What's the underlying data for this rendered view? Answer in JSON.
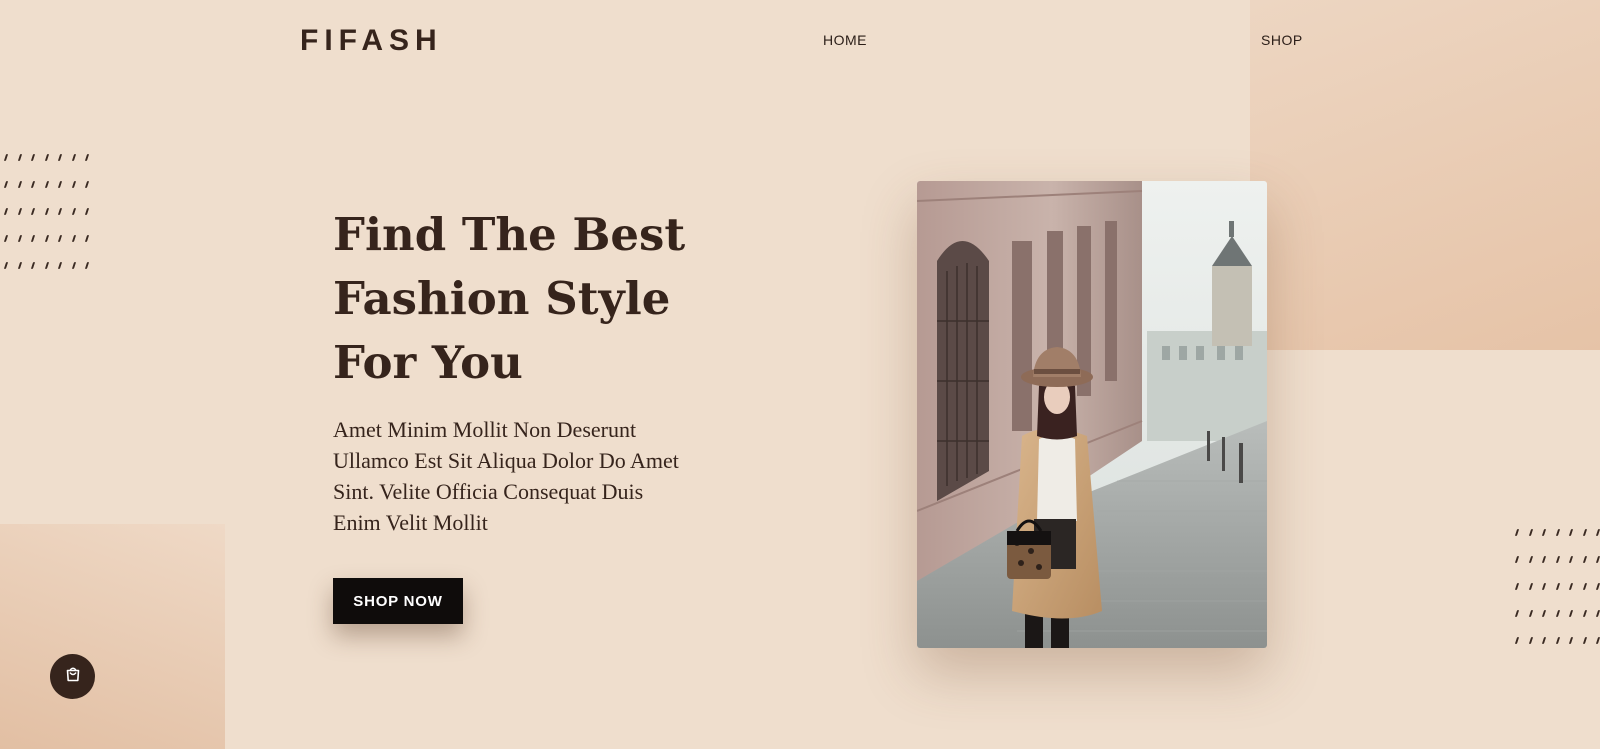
{
  "header": {
    "logo": "FIFASH",
    "nav": {
      "home": "HOME",
      "shop": "SHOP"
    }
  },
  "hero": {
    "title_lines": [
      "Find The Best",
      "Fashion Style",
      "For You"
    ],
    "subtitle_lines": [
      "Amet Minim Mollit Non Deserunt",
      "Ullamco Est Sit Aliqua Dolor Do Amet",
      "Sint. Velite Officia Consequat Duis",
      "Enim Velit Mollit"
    ],
    "cta_label": "SHOP NOW"
  },
  "icons": {
    "cart": "shopping-bag-icon"
  },
  "colors": {
    "background": "#efdecd",
    "accent_block": "#e6c3a7",
    "text_dark": "#36241c",
    "button_bg": "#0f0c0b",
    "button_text": "#ffffff"
  }
}
